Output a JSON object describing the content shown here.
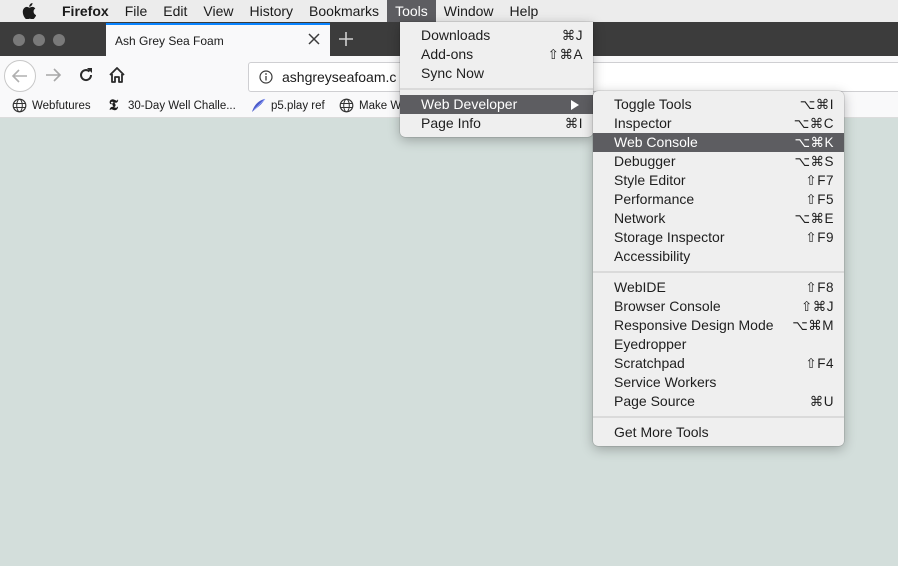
{
  "menubar": {
    "apple": "apple-logo",
    "items": [
      {
        "label": "Firefox",
        "bold": true
      },
      {
        "label": "File"
      },
      {
        "label": "Edit"
      },
      {
        "label": "View"
      },
      {
        "label": "History"
      },
      {
        "label": "Bookmarks"
      },
      {
        "label": "Tools",
        "active": true
      },
      {
        "label": "Window"
      },
      {
        "label": "Help"
      }
    ]
  },
  "browser": {
    "tab": {
      "title": "Ash Grey Sea Foam"
    },
    "url": "ashgreyseafoam.com",
    "url_visible": "ashgreyseafoam.c",
    "bookmarks": [
      {
        "label": "Webfutures",
        "icon": "globe-icon"
      },
      {
        "label": "30-Day Well Challe...",
        "icon": "nytimes-icon"
      },
      {
        "label": "p5.play ref",
        "icon": "feather-icon"
      },
      {
        "label": "Make W",
        "icon": "globe-icon"
      }
    ],
    "page_background": "#d3dedb"
  },
  "tools_menu": {
    "items": [
      {
        "label": "Downloads",
        "shortcut": "⌘J"
      },
      {
        "label": "Add-ons",
        "shortcut": "⇧⌘A"
      },
      {
        "label": "Sync Now",
        "shortcut": ""
      },
      {
        "separator": true
      },
      {
        "label": "Web Developer",
        "submenu": true,
        "highlighted": true
      },
      {
        "label": "Page Info",
        "shortcut": "⌘I"
      }
    ]
  },
  "web_developer_menu": {
    "items": [
      {
        "label": "Toggle Tools",
        "shortcut": "⌥⌘I"
      },
      {
        "label": "Inspector",
        "shortcut": "⌥⌘C"
      },
      {
        "label": "Web Console",
        "shortcut": "⌥⌘K",
        "highlighted": true
      },
      {
        "label": "Debugger",
        "shortcut": "⌥⌘S"
      },
      {
        "label": "Style Editor",
        "shortcut": "⇧F7"
      },
      {
        "label": "Performance",
        "shortcut": "⇧F5"
      },
      {
        "label": "Network",
        "shortcut": "⌥⌘E"
      },
      {
        "label": "Storage Inspector",
        "shortcut": "⇧F9"
      },
      {
        "label": "Accessibility",
        "shortcut": ""
      },
      {
        "separator": true
      },
      {
        "label": "WebIDE",
        "shortcut": "⇧F8"
      },
      {
        "label": "Browser Console",
        "shortcut": "⇧⌘J"
      },
      {
        "label": "Responsive Design Mode",
        "shortcut": "⌥⌘M"
      },
      {
        "label": "Eyedropper",
        "shortcut": ""
      },
      {
        "label": "Scratchpad",
        "shortcut": "⇧F4"
      },
      {
        "label": "Service Workers",
        "shortcut": ""
      },
      {
        "label": "Page Source",
        "shortcut": "⌘U"
      },
      {
        "separator": true
      },
      {
        "label": "Get More Tools",
        "shortcut": ""
      }
    ]
  },
  "colors": {
    "menu_highlight": "#5d5d61",
    "tab_accent": "#0a84ff",
    "tabstrip": "#3c3c3c"
  }
}
